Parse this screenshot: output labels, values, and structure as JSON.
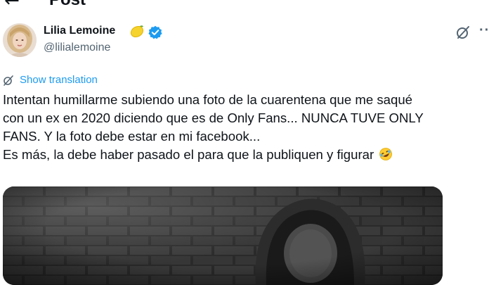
{
  "header": {
    "title": "Post"
  },
  "author": {
    "name": "Lilia Lemoine",
    "handle": "@lilialemoine"
  },
  "icons": {
    "back": "arrow-left-icon",
    "badge_emoji": "lemon-emoji-icon",
    "verified": "verified-badge-icon",
    "grok": "grok-icon",
    "more": "more-options-icon",
    "translate": "translate-icon",
    "text_emoji": "rolling-on-floor-laughing-emoji"
  },
  "colors": {
    "link": "#1d9bf0",
    "verified": "#1d9bf0",
    "secondary_text": "#536471"
  },
  "translation": {
    "label": "Show translation"
  },
  "tweet": {
    "lines": [
      "Intentan humillarme subiendo una foto de la cuarentena que me saqué",
      "con un ex en 2020 diciendo que es de Only Fans... NUNCA TUVE ONLY",
      "FANS. Y la foto debe estar en mi facebook...",
      "Es más, la debe haber pasado el para que la publiquen y figurar"
    ]
  },
  "more_glyph": "··"
}
